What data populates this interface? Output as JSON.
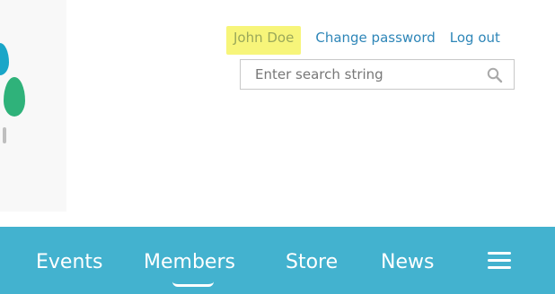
{
  "header": {
    "user_name": "John Doe",
    "change_password_label": "Change password",
    "logout_label": "Log out"
  },
  "search": {
    "placeholder": "Enter search string"
  },
  "nav": {
    "items": [
      {
        "label": "Events"
      },
      {
        "label": "Members"
      },
      {
        "label": "Store"
      },
      {
        "label": "News"
      }
    ],
    "active": "Members"
  },
  "colors": {
    "nav_bg": "#43b2cf",
    "link": "#2e86b8",
    "highlight": "#f7f57a"
  },
  "icons": {
    "search": "search-icon",
    "menu": "menu-icon",
    "logo": "logo-drops-icon"
  }
}
